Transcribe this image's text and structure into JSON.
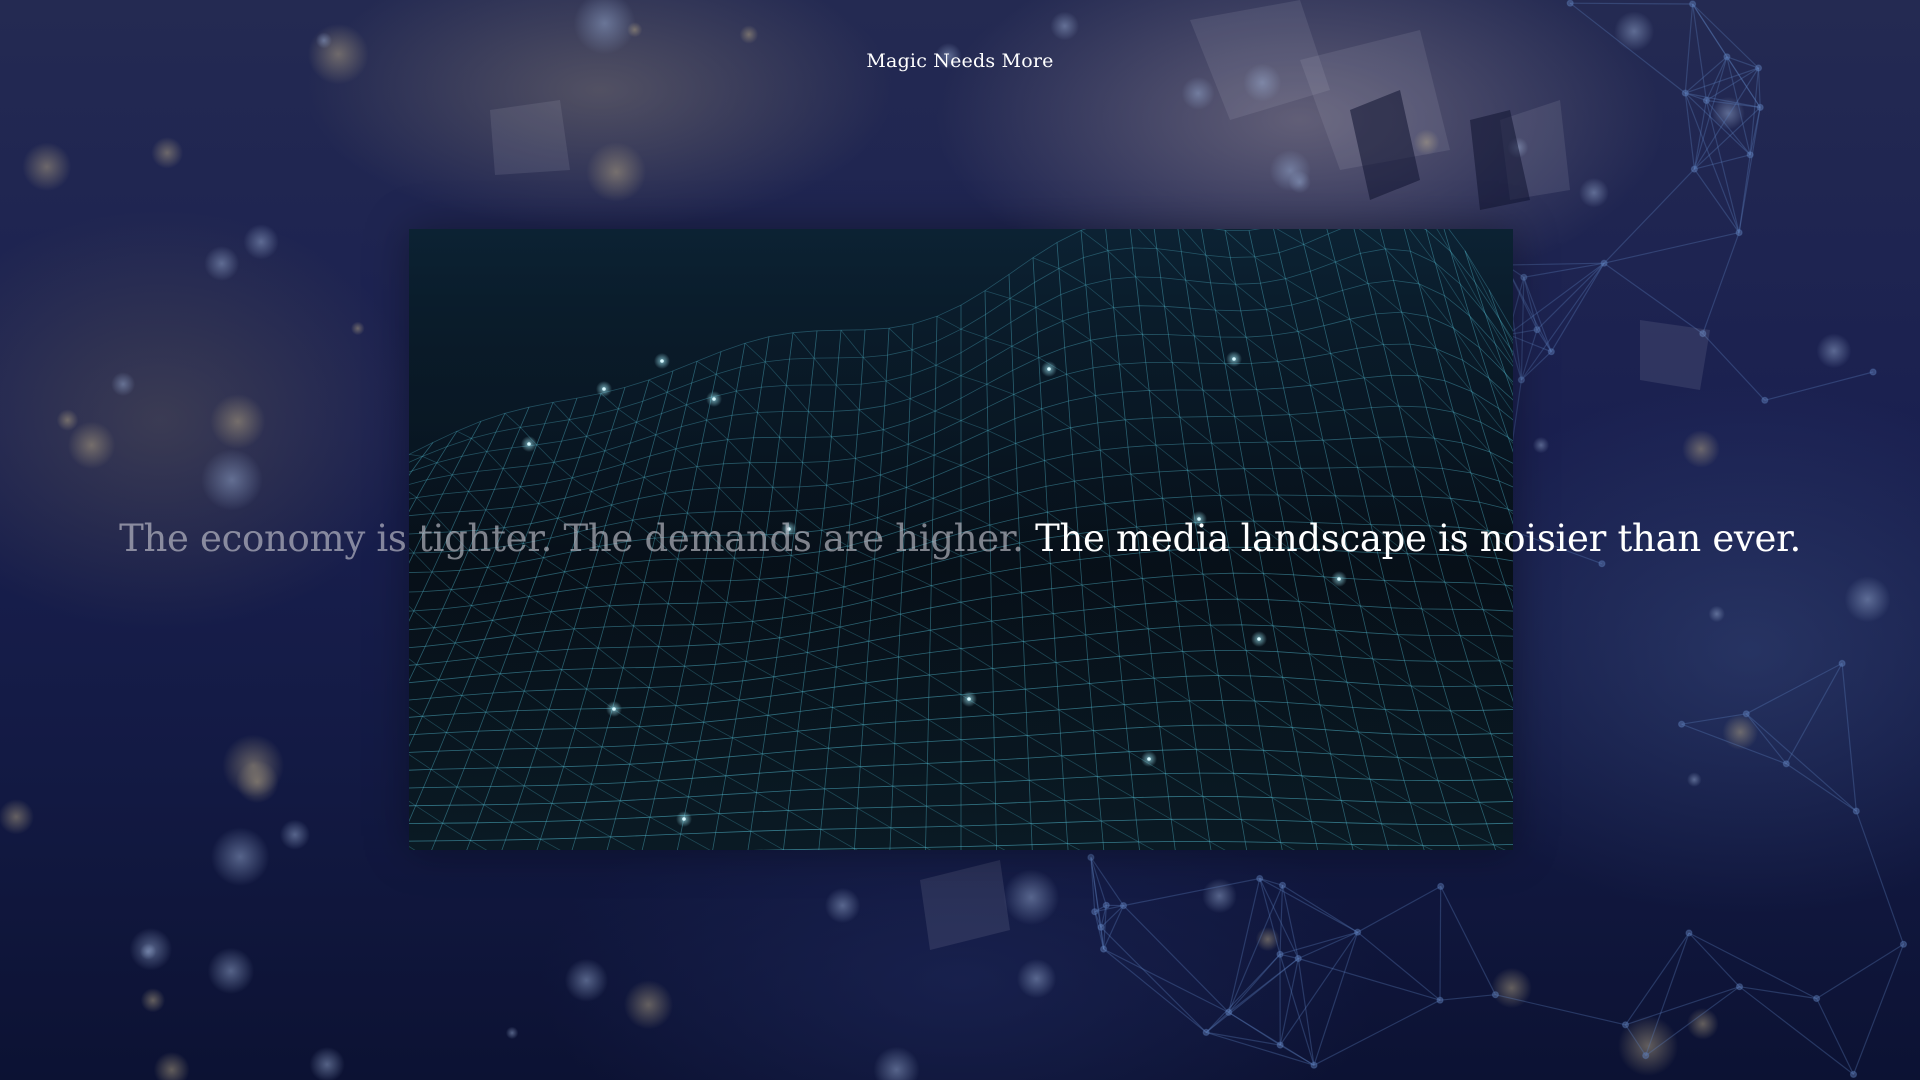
{
  "header": {
    "site_title": "Magic Needs More"
  },
  "hero": {
    "tagline": {
      "dim_1": "The economy is tighter.",
      "dim_2": "The demands are higher.",
      "bright": "The media landscape is noisier than ever."
    }
  },
  "colors": {
    "background": "#1a2050",
    "mesh": "#4fb3c8",
    "dim_text": "#c8c8d2",
    "bright_text": "#ffffff"
  }
}
